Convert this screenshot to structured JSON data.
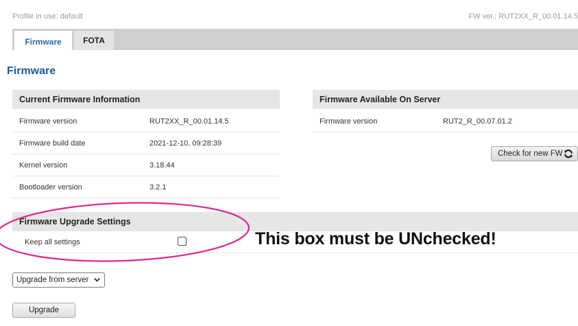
{
  "header": {
    "profile_text": "Profile in use: default",
    "fw_version_text": "FW ver.: RUT2XX_R_00.01.14.5"
  },
  "tabs": [
    {
      "label": "Firmware",
      "active": true
    },
    {
      "label": "FOTA",
      "active": false
    }
  ],
  "page_title": "Firmware",
  "current_info": {
    "title": "Current Firmware Information",
    "rows": [
      {
        "label": "Firmware version",
        "value": "RUT2XX_R_00.01.14.5"
      },
      {
        "label": "Firmware build date",
        "value": "2021-12-10, 09:28:39"
      },
      {
        "label": "Kernel version",
        "value": "3.18.44"
      },
      {
        "label": "Bootloader version",
        "value": "3.2.1"
      }
    ]
  },
  "server_info": {
    "title": "Firmware Available On Server",
    "rows": [
      {
        "label": "Firmware version",
        "value": "RUT2_R_00.07.01.2"
      }
    ],
    "check_button_label": "Check for new FW"
  },
  "upgrade_settings": {
    "title": "Firmware Upgrade Settings",
    "keep_settings_label": "Keep all settings",
    "keep_settings_checked": false
  },
  "annotation": {
    "text": "This box must be UNchecked!",
    "ellipse_color": "#e0268a"
  },
  "upgrade_source": {
    "selected": "Upgrade from server"
  },
  "upgrade_button_label": "Upgrade",
  "colors": {
    "accent": "#1f5a99",
    "tab_active_text": "#2a6aa8",
    "section_header_bg": "#e6e6e6"
  }
}
